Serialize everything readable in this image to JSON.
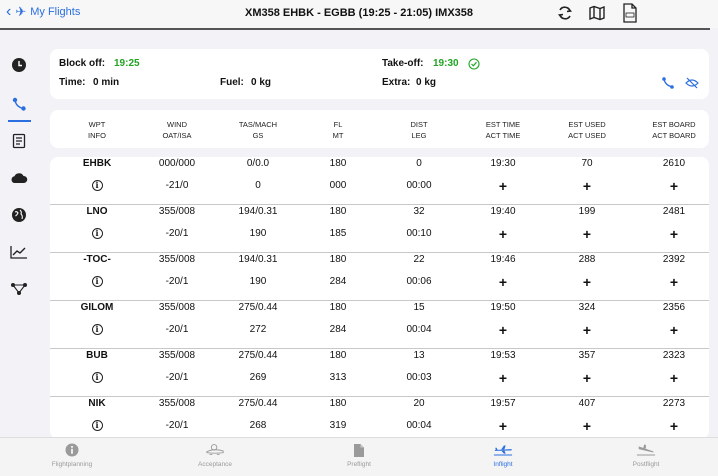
{
  "header": {
    "back_label": "My Flights",
    "title": "XM358 EHBK - EGBB (19:25 - 21:05) IMX358"
  },
  "info": {
    "block_off_label": "Block off:",
    "block_off_value": "19:25",
    "time_label": "Time:",
    "time_value": "0 min",
    "fuel_label": "Fuel:",
    "fuel_value": "0 kg",
    "takeoff_label": "Take-off:",
    "takeoff_value": "19:30",
    "extra_label": "Extra:",
    "extra_value": "0 kg"
  },
  "columns": [
    [
      "WPT",
      "INFO"
    ],
    [
      "WIND",
      "OAT/ISA"
    ],
    [
      "TAS/MACH",
      "GS"
    ],
    [
      "FL",
      "MT"
    ],
    [
      "DIST",
      "LEG"
    ],
    [
      "EST TIME",
      "ACT TIME"
    ],
    [
      "EST USED",
      "ACT USED"
    ],
    [
      "EST BOARD",
      "ACT BOARD"
    ]
  ],
  "rows": [
    {
      "wpt": "EHBK",
      "wind": "000/000",
      "oat": "-21/0",
      "tas": "0/0.0",
      "gs": "0",
      "fl": "180",
      "mt": "000",
      "dist": "0",
      "leg": "00:00",
      "est_time": "19:30",
      "est_used": "70",
      "est_board": "2610"
    },
    {
      "wpt": "LNO",
      "wind": "355/008",
      "oat": "-20/1",
      "tas": "194/0.31",
      "gs": "190",
      "fl": "180",
      "mt": "185",
      "dist": "32",
      "leg": "00:10",
      "est_time": "19:40",
      "est_used": "199",
      "est_board": "2481"
    },
    {
      "wpt": "-TOC-",
      "wind": "355/008",
      "oat": "-20/1",
      "tas": "194/0.31",
      "gs": "190",
      "fl": "180",
      "mt": "284",
      "dist": "22",
      "leg": "00:06",
      "est_time": "19:46",
      "est_used": "288",
      "est_board": "2392"
    },
    {
      "wpt": "GILOM",
      "wind": "355/008",
      "oat": "-20/1",
      "tas": "275/0.44",
      "gs": "272",
      "fl": "180",
      "mt": "284",
      "dist": "15",
      "leg": "00:04",
      "est_time": "19:50",
      "est_used": "324",
      "est_board": "2356"
    },
    {
      "wpt": "BUB",
      "wind": "355/008",
      "oat": "-20/1",
      "tas": "275/0.44",
      "gs": "269",
      "fl": "180",
      "mt": "313",
      "dist": "13",
      "leg": "00:03",
      "est_time": "19:53",
      "est_used": "357",
      "est_board": "2323"
    },
    {
      "wpt": "NIK",
      "wind": "355/008",
      "oat": "-20/1",
      "tas": "275/0.44",
      "gs": "268",
      "fl": "180",
      "mt": "319",
      "dist": "20",
      "leg": "00:04",
      "est_time": "19:57",
      "est_used": "407",
      "est_board": "2273"
    }
  ],
  "row_glyphs": {
    "info": "i",
    "plus": "+"
  },
  "tabs": [
    {
      "label": "Flightplanning",
      "icon": "info-icon"
    },
    {
      "label": "Acceptance",
      "icon": "aircraft-check-icon"
    },
    {
      "label": "Preflight",
      "icon": "document-icon"
    },
    {
      "label": "Inflight",
      "icon": "plane-icon"
    },
    {
      "label": "Postflight",
      "icon": "landing-icon"
    }
  ],
  "colors": {
    "accent": "#2b6fe0",
    "green": "#22a323"
  }
}
